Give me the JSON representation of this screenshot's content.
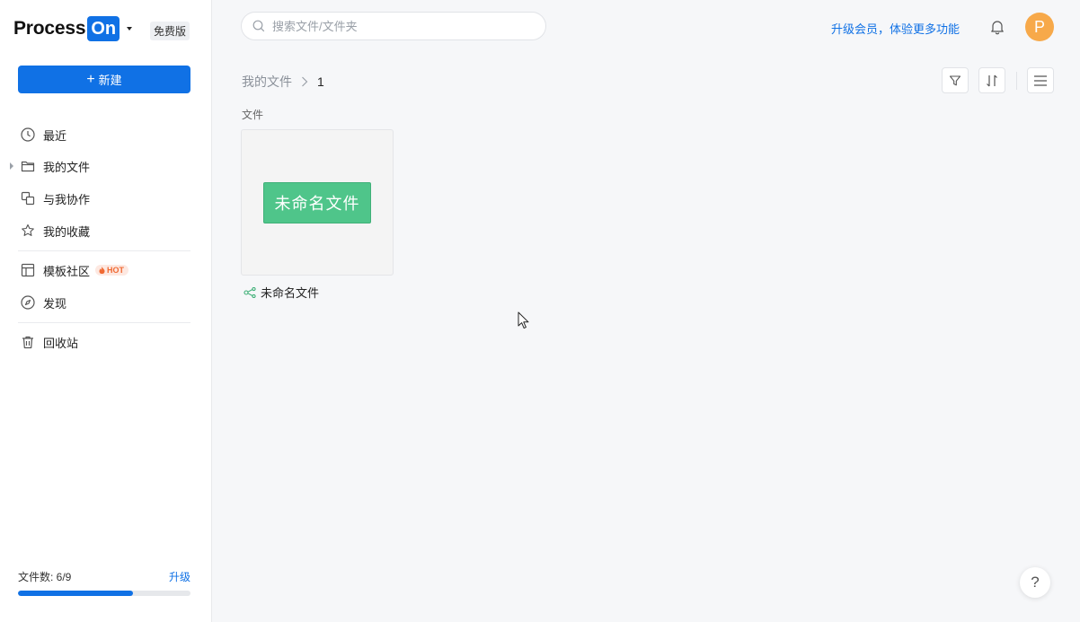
{
  "brand": {
    "name": "Process",
    "highlight": "On",
    "plan": "免费版"
  },
  "actions": {
    "new_label": "新建"
  },
  "nav_group1_item0": "最近",
  "nav_group1_item1": "我的文件",
  "nav_group1_item2": "与我协作",
  "nav_group1_item3": "我的收藏",
  "nav_group2_item0": "模板社区",
  "nav_group2_item0_badge": "HOT",
  "nav_group2_item1": "发现",
  "nav_group3_item0": "回收站",
  "quota": {
    "label": "文件数: 6/9",
    "used": 6,
    "total": 9,
    "upgrade_label": "升级"
  },
  "header": {
    "search_placeholder": "搜索文件/文件夹",
    "upgrade_text": "升级会员，体验更多功能",
    "avatar_letter": "P"
  },
  "breadcrumb": {
    "root": "我的文件",
    "current": "1"
  },
  "content": {
    "section_label": "文件"
  },
  "file0": {
    "thumb_text": "未命名文件",
    "name": "未命名文件"
  },
  "colors": {
    "accent": "#1071e5",
    "avatar": "#f7a94a",
    "thumb": "#4fc58a",
    "hot": "#f06a33"
  },
  "icons": {
    "recent": "clock-icon",
    "files": "folder-icon",
    "collab": "collab-icon",
    "favorites": "star-icon",
    "templates": "layout-icon",
    "discover": "compass-icon",
    "trash": "trash-icon",
    "search": "search-icon",
    "bell": "bell-icon",
    "filter": "filter-icon",
    "sort": "sort-icon",
    "list": "list-view-icon",
    "mindmap": "mindmap-icon",
    "help": "help-icon"
  }
}
